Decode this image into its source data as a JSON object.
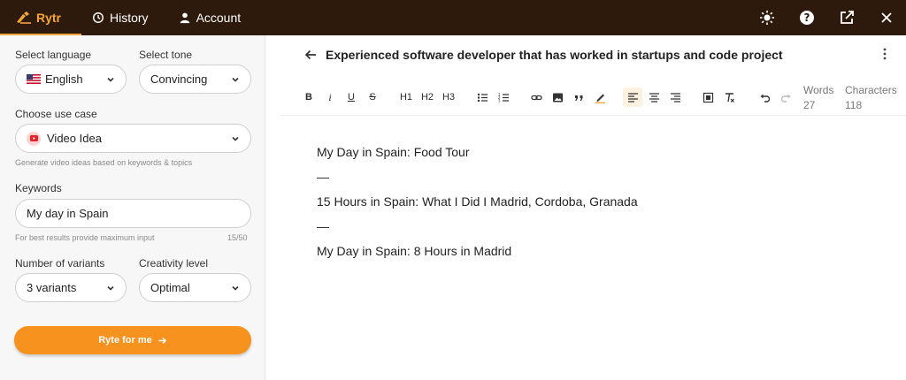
{
  "app": {
    "brand": "Rytr",
    "nav": {
      "history": "History",
      "account": "Account"
    },
    "brand_color": "#f6a53b",
    "topbar_bg": "#2d1a0c"
  },
  "sidebar": {
    "language": {
      "label": "Select language",
      "value": "English",
      "flag_icon": "us-flag-icon"
    },
    "tone": {
      "label": "Select tone",
      "value": "Convincing"
    },
    "use_case": {
      "label": "Choose use case",
      "value": "Video Idea",
      "hint": "Generate video ideas based on keywords & topics",
      "icon": "youtube-icon"
    },
    "keywords": {
      "label": "Keywords",
      "value": "My day in Spain",
      "hint": "For best results provide maximum input",
      "count": "15/50"
    },
    "variants": {
      "label": "Number of variants",
      "value": "3 variants"
    },
    "creativity": {
      "label": "Creativity level",
      "value": "Optimal"
    },
    "cta": "Ryte for me",
    "cta_color": "#f7921e"
  },
  "document": {
    "title": "Experienced software developer that has worked in startups and code project",
    "toolbar": {
      "bold": "B",
      "italic": "i",
      "underline": "U",
      "strike": "S",
      "h1": "H1",
      "h2": "H2",
      "h3": "H3"
    },
    "stats": {
      "words_label": "Words",
      "words": "27",
      "chars_label": "Characters",
      "chars": "118"
    },
    "lines": [
      "My Day in Spain: Food Tour",
      "—",
      "15 Hours in Spain: What I Did I Madrid, Cordoba, Granada",
      "—",
      "My Day in Spain: 8 Hours in Madrid"
    ]
  }
}
